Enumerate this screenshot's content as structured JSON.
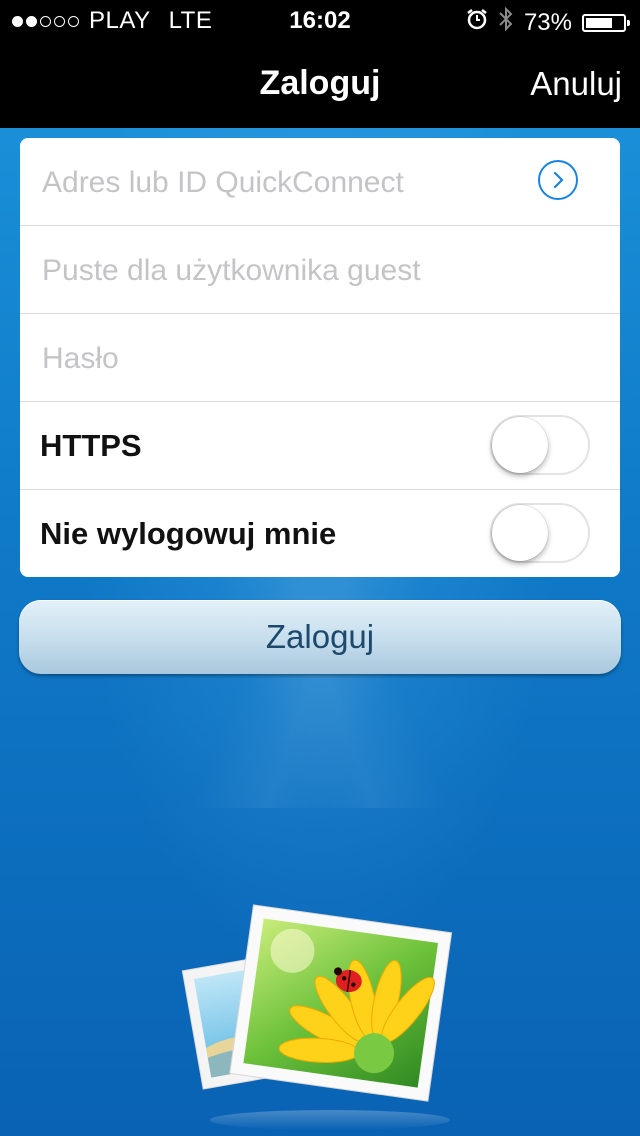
{
  "status_bar": {
    "signal_dots_filled": 2,
    "signal_dots_total": 5,
    "carrier": "PLAY",
    "network": "LTE",
    "time": "16:02",
    "alarm_icon": "alarm-clock-icon",
    "bluetooth_icon": "bluetooth-icon",
    "battery_text": "73%",
    "battery_level": 0.73
  },
  "nav": {
    "title": "Zaloguj",
    "cancel_label": "Anuluj"
  },
  "form": {
    "address": {
      "value": "",
      "placeholder": "Adres lub ID QuickConnect",
      "go_icon": "chevron-right-circle-icon"
    },
    "username": {
      "value": "",
      "placeholder": "Puste dla użytkownika guest"
    },
    "password": {
      "value": "",
      "placeholder": "Hasło"
    },
    "https": {
      "label": "HTTPS",
      "enabled": false
    },
    "stay_logged_in": {
      "label": "Nie wylogowuj mnie",
      "enabled": false
    }
  },
  "login_button_label": "Zaloguj",
  "colors": {
    "accent": "#1a82e2",
    "background_top": "#1a8fd8",
    "background_bottom": "#0a62b4",
    "nav_bar": "#000000",
    "button_text": "#1d4a6c"
  },
  "logo_icon": "photo-station-logo-icon"
}
